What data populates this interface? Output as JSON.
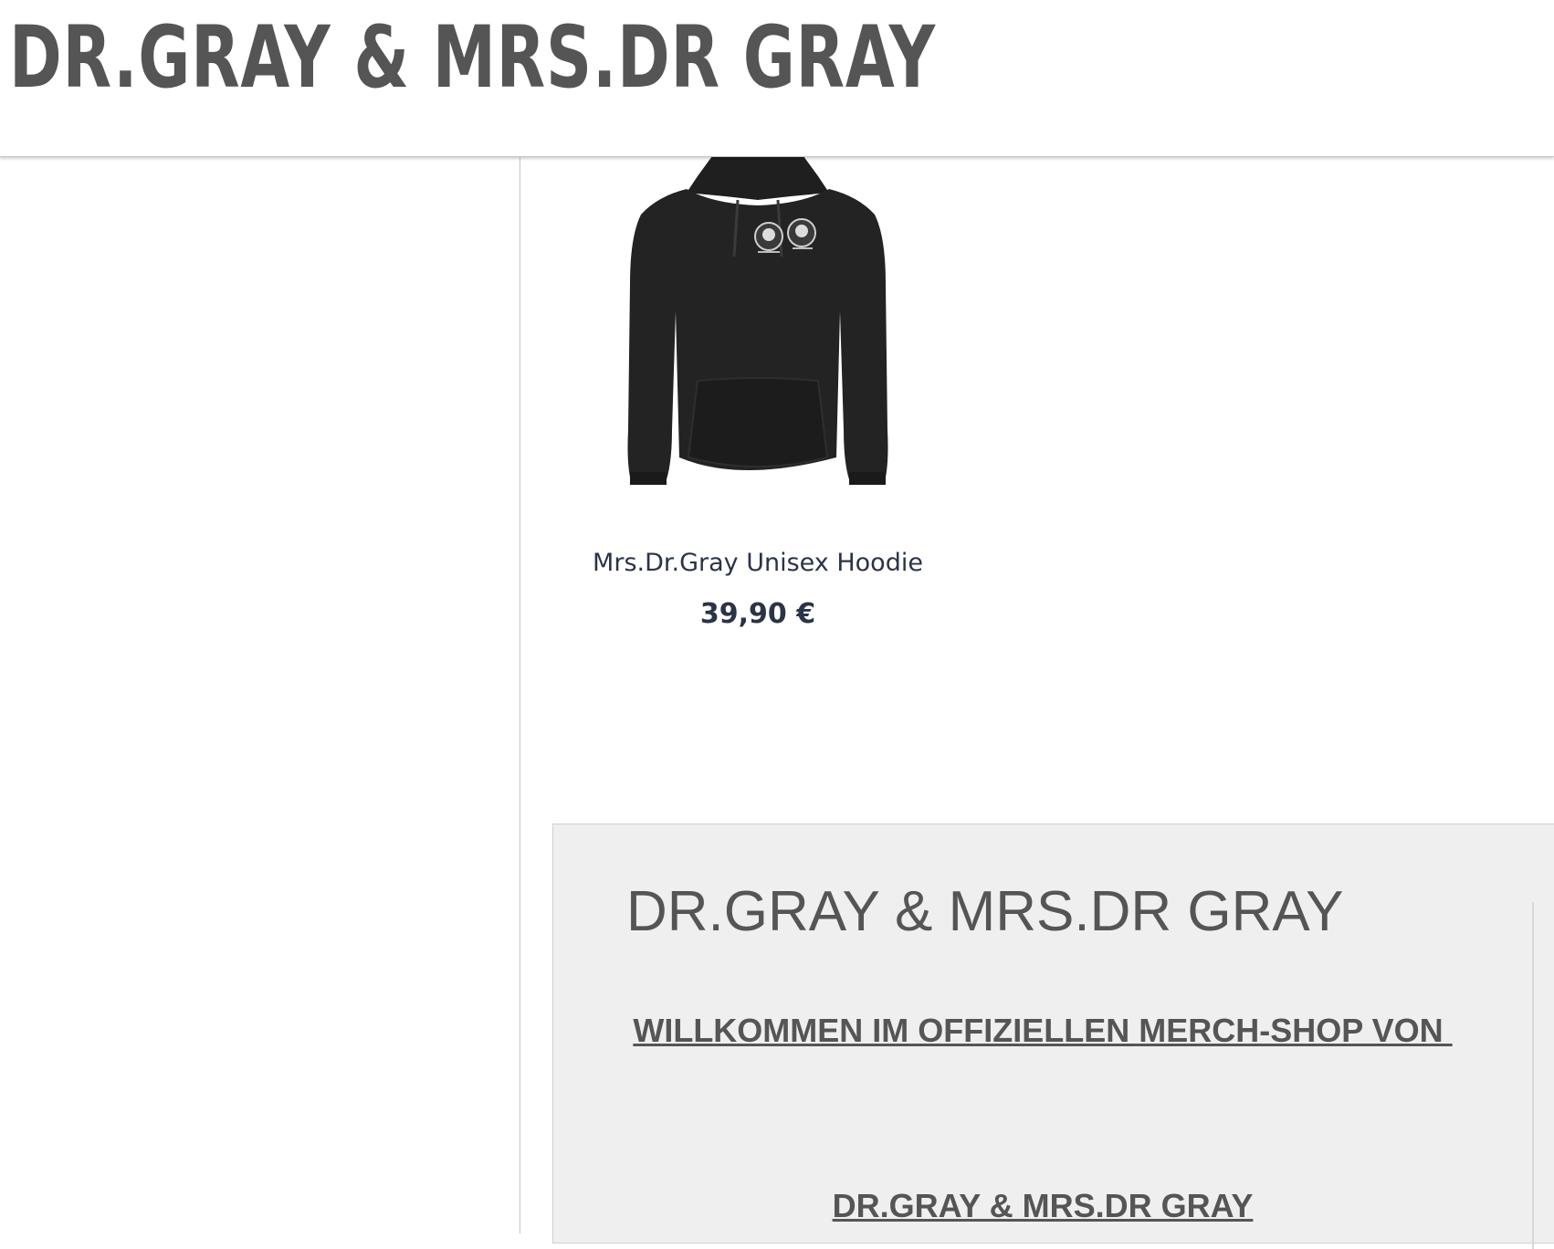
{
  "header": {
    "brand_title": "DR.GRAY & MRS.DR GRAY"
  },
  "product": {
    "title": "Mrs.Dr.Gray Unisex Hoodie",
    "price": "39,90 €",
    "image_icon": "black-hoodie-image",
    "colors": {
      "hoodie": "#222222",
      "text": "#2a3446"
    }
  },
  "info": {
    "heading": "DR.GRAY & MRS.DR GRAY",
    "welcome": "WILLKOMMEN IM OFFIZIELLEN MERCH-SHOP VON ",
    "brand_line": "DR.GRAY & MRS.DR GRAY"
  },
  "colors": {
    "header_text": "#555555",
    "divider": "#b9c7d3",
    "info_background": "#efefef"
  }
}
